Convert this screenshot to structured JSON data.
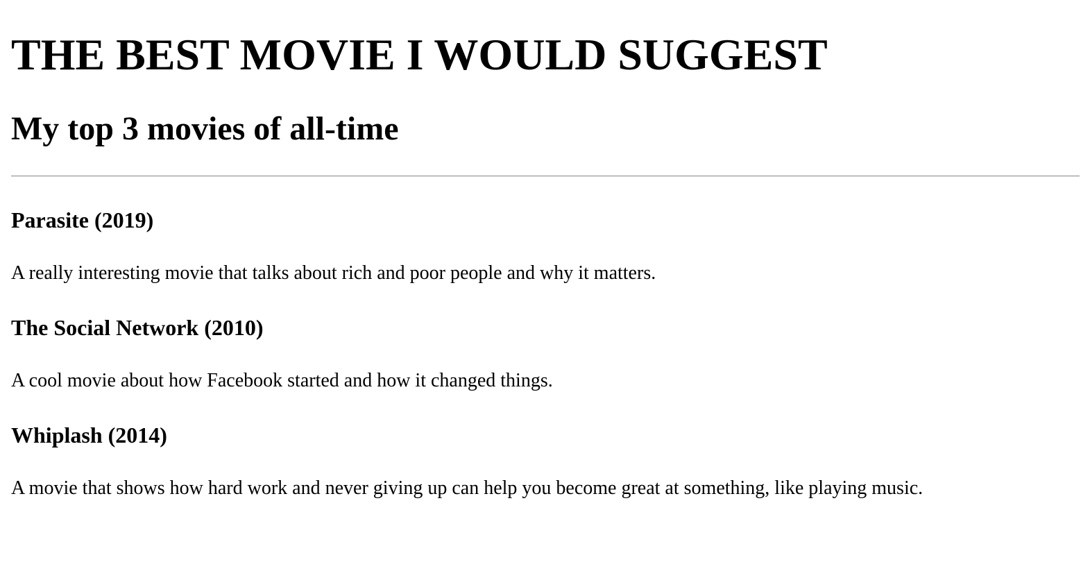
{
  "page": {
    "heading": "THE BEST MOVIE I WOULD SUGGEST",
    "subheading": "My top 3 movies of all-time"
  },
  "movies": [
    {
      "title": "Parasite (2019)",
      "description": "A really interesting movie that talks about rich and poor people and why it matters."
    },
    {
      "title": "The Social Network (2010)",
      "description": "A cool movie about how Facebook started and how it changed things."
    },
    {
      "title": "Whiplash (2014)",
      "description": "A movie that shows how hard work and never giving up can help you become great at something, like playing music."
    }
  ]
}
